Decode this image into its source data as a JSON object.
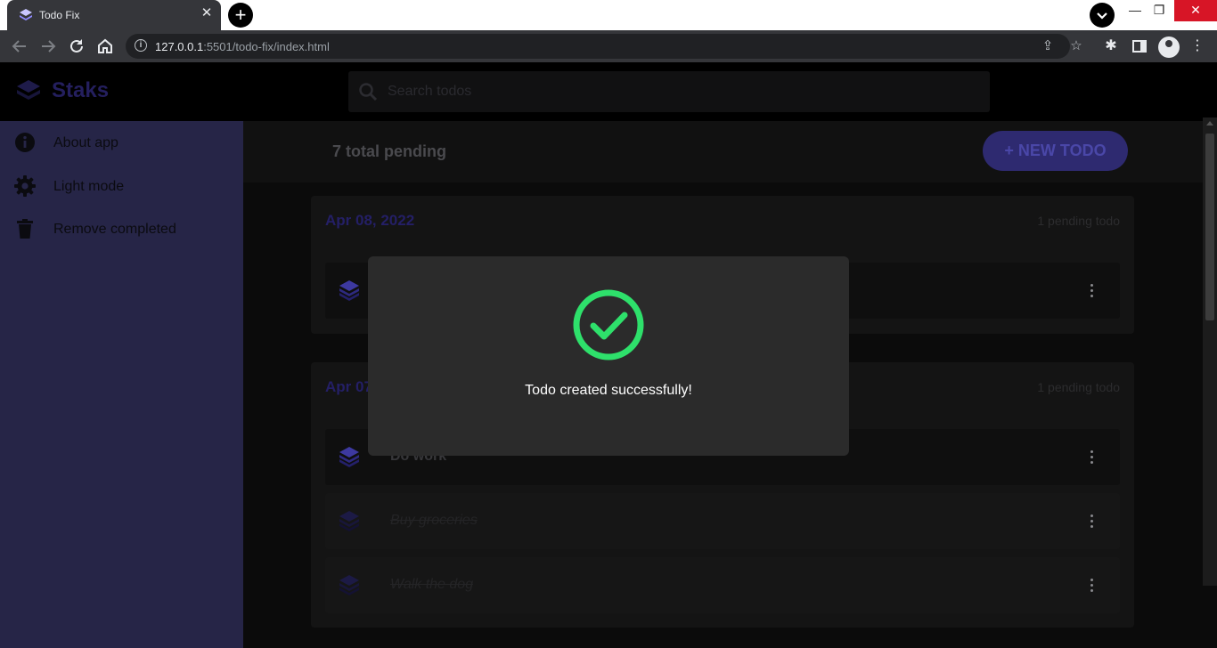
{
  "browser": {
    "tab_title": "Todo Fix",
    "tab_close": "✕",
    "new_tab": "+",
    "url_host": "127.0.0.1",
    "url_rest": ":5501/todo-fix/index.html",
    "window_controls": {
      "minimize": "—",
      "restore": "❐",
      "close": "✕"
    },
    "icons": [
      "back-icon",
      "forward-icon",
      "reload-icon",
      "home-icon",
      "site-info-icon",
      "share-icon",
      "bookmark-star-icon",
      "extensions-icon",
      "side-panel-icon",
      "profile-icon",
      "menu-icon"
    ]
  },
  "app": {
    "brand": "Staks",
    "search_placeholder": "Search todos",
    "sidebar": {
      "items": [
        {
          "label": "About app",
          "icon": "info-icon"
        },
        {
          "label": "Light mode",
          "icon": "gear-icon"
        },
        {
          "label": "Remove completed",
          "icon": "trash-icon"
        }
      ]
    },
    "header": {
      "pending_total": "7 total pending",
      "new_todo_label": "+ NEW TODO"
    },
    "groups": [
      {
        "date": "Apr 08, 2022",
        "count": "1 pending todo",
        "todos": [
          {
            "text": "",
            "done": false
          }
        ]
      },
      {
        "date": "Apr 07, 2022",
        "count": "1 pending todo",
        "todos": [
          {
            "text": "Do work",
            "done": false
          },
          {
            "text": "Buy groceries",
            "done": true
          },
          {
            "text": "Walk the dog",
            "done": true
          }
        ]
      }
    ],
    "modal": {
      "message": "Todo created successfully!",
      "icon": "check-circle-icon"
    }
  },
  "colors": {
    "accent": "#4a47a8",
    "success": "#2ee06b",
    "sidebar": "#262547",
    "modal": "#2b2b2b"
  }
}
